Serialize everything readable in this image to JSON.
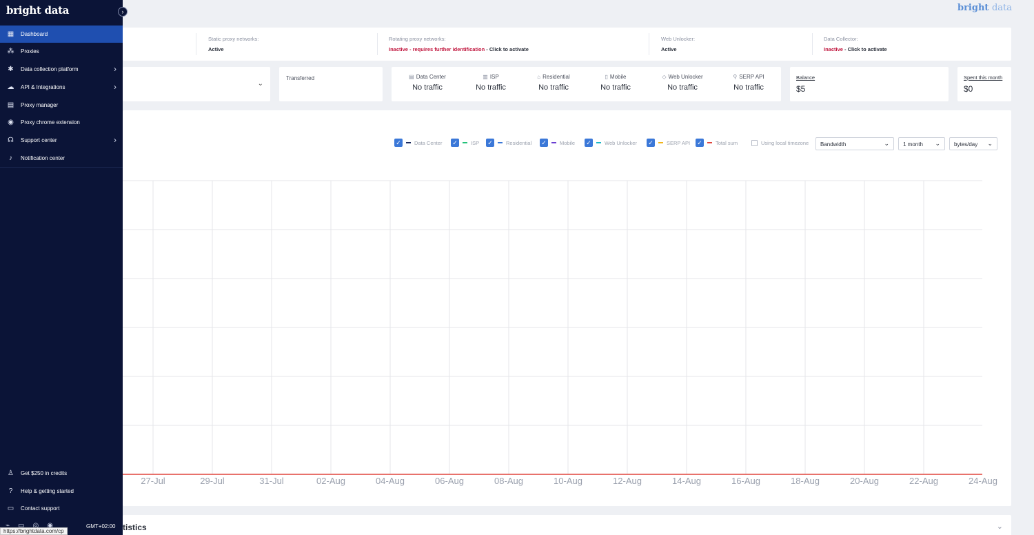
{
  "sidebar": {
    "logo": "bright data",
    "items": [
      {
        "label": "Dashboard",
        "icon": "grid-icon"
      },
      {
        "label": "Proxies",
        "icon": "network-icon"
      },
      {
        "label": "Data collection platform",
        "icon": "spider-icon"
      },
      {
        "label": "API & Integrations",
        "icon": "cloud-icon"
      },
      {
        "label": "Proxy manager",
        "icon": "lpm-icon"
      },
      {
        "label": "Proxy chrome extension",
        "icon": "chrome-icon"
      },
      {
        "label": "Support center",
        "icon": "headset-icon"
      },
      {
        "label": "Notification center",
        "icon": "bell-icon"
      }
    ],
    "bottom_items": [
      {
        "label": "Get $250 in credits",
        "icon": "user-icon"
      },
      {
        "label": "Help & getting started",
        "icon": "help-icon"
      },
      {
        "label": "Contact support",
        "icon": "chat-icon"
      }
    ],
    "timezone": "GMT+02:00",
    "status_url": "https://brightdata.com/cp"
  },
  "topbar": {
    "brand_bold": "bright",
    "brand_light": "data"
  },
  "status": {
    "static_label": "Static proxy networks:",
    "static_value": "Active",
    "rotating_label": "Rotating proxy networks:",
    "rotating_value": "Inactive - requires further identification",
    "rotating_action": " - Click to activate",
    "unlocker_label": "Web Unlocker:",
    "unlocker_value": "Active",
    "collector_label": "Data Collector:",
    "collector_value": "Inactive",
    "collector_action": " - Click to activate"
  },
  "transferred_label": "Transferred",
  "traffic": [
    {
      "label": "Data Center",
      "value": "No traffic",
      "icon": "server-icon"
    },
    {
      "label": "ISP",
      "value": "No traffic",
      "icon": "building-icon"
    },
    {
      "label": "Residential",
      "value": "No traffic",
      "icon": "house-icon"
    },
    {
      "label": "Mobile",
      "value": "No traffic",
      "icon": "phone-icon"
    },
    {
      "label": "Web Unlocker",
      "value": "No traffic",
      "icon": "shield-icon"
    },
    {
      "label": "SERP API",
      "value": "No traffic",
      "icon": "search-icon"
    }
  ],
  "balance": {
    "label": "Balance",
    "value": "$5"
  },
  "spent": {
    "label": "Spent this month",
    "value": "$0"
  },
  "chart_controls": {
    "legend": [
      {
        "label": "Data Center",
        "color": "#1b2a5e"
      },
      {
        "label": "ISP",
        "color": "#22c27a"
      },
      {
        "label": "Residential",
        "color": "#3b78d8"
      },
      {
        "label": "Mobile",
        "color": "#6a3fd1"
      },
      {
        "label": "Web Unlocker",
        "color": "#19b7c7"
      },
      {
        "label": "SERP API",
        "color": "#f2b51b"
      },
      {
        "label": "Total sum",
        "color": "#e0443c"
      }
    ],
    "timezone_label": "Using local timezone",
    "metric": "Bandwidth",
    "period": "1 month",
    "unit": "bytes/day"
  },
  "chart_data": {
    "type": "line",
    "x": [
      "27-Jul",
      "29-Jul",
      "31-Jul",
      "02-Aug",
      "04-Aug",
      "06-Aug",
      "08-Aug",
      "10-Aug",
      "12-Aug",
      "14-Aug",
      "16-Aug",
      "18-Aug",
      "20-Aug",
      "22-Aug",
      "24-Aug"
    ],
    "series": [
      {
        "name": "Total sum",
        "values": [
          0,
          0,
          0,
          0,
          0,
          0,
          0,
          0,
          0,
          0,
          0,
          0,
          0,
          0,
          0
        ],
        "color": "#e0443c"
      }
    ],
    "grid": true
  },
  "bottom_title": "tistics"
}
